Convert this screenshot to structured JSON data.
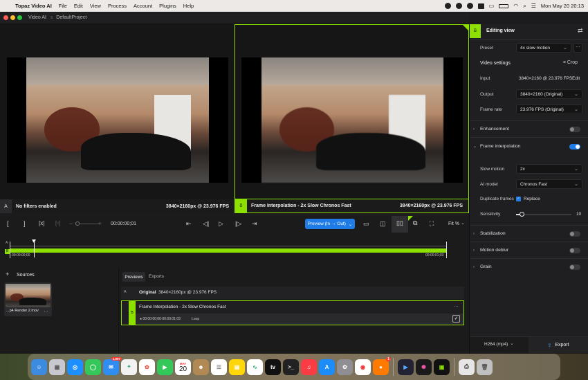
{
  "menubar": {
    "app": "Topaz Video AI",
    "items": [
      "File",
      "Edit",
      "View",
      "Process",
      "Account",
      "Plugins",
      "Help"
    ],
    "clock": "Mon May 20  20:13"
  },
  "titlebar": {
    "app": "Video AI",
    "sep": "S",
    "project": "DefaultProject"
  },
  "preview_a": {
    "tag": "A",
    "label": "No filters enabled",
    "meta": "3840×2160px @ 23.976 FPS"
  },
  "preview_b": {
    "tag": "0",
    "label": "Frame Interpolation -  2x Slow Chronos Fast",
    "meta": "3840×2160px @ 23.976 FPS"
  },
  "toolbar": {
    "bracket_in": "[",
    "bracket_out": "]",
    "timecode": "00:00:00;01",
    "preview_btn": "Preview (In → Out)",
    "fit": "Fit %"
  },
  "timeline": {
    "start": "00:00:00;00",
    "end": "00:00:01;03"
  },
  "sources": {
    "title": "Sources",
    "clip": "...p4 Render 2.mov"
  },
  "previews": {
    "tabs": [
      "Previews",
      "Exports"
    ],
    "original_tag": "A",
    "original_label": "Original",
    "original_meta": "3840×2160px @ 23.976 FPS",
    "item_tag": "B",
    "item_label": "Frame Interpolation -  2x Slow Chronos Fast",
    "item_range": "00:00:00;00-00:00:01;03",
    "item_loop": "Loop"
  },
  "sidebar": {
    "tag": "B",
    "title": "Editing view",
    "preset_label": "Preset",
    "preset_value": "4x slow motion",
    "video_settings": "Video settings",
    "crop": "Crop",
    "input_label": "Input",
    "input_value": "3840×2160 @ 23.976 FPS",
    "edit": "Edit",
    "output_label": "Output",
    "output_value": "3840×2160 (Original)",
    "framerate_label": "Frame rate",
    "framerate_value": "23.976 FPS (Original)",
    "enhancement": "Enhancement",
    "frame_interp": "Frame interpolation",
    "slowmo_label": "Slow motion",
    "slowmo_value": "2x",
    "aimodel_label": "AI model",
    "aimodel_value": "Chronos Fast",
    "dup_label": "Duplicate frames",
    "dup_value": "Replace",
    "sens_label": "Sensitivity",
    "sens_value": "10",
    "stabilization": "Stabilization",
    "motion_deblur": "Motion deblur",
    "grain": "Grain",
    "codec": "H264 (mp4)",
    "export": "Export"
  },
  "dock": {
    "mail_badge": "1,907",
    "cal_month": "MAY",
    "cal_day": "20",
    "app_badge": "1"
  },
  "colors": {
    "accent": "#8ee000",
    "blue": "#1f7ce6"
  }
}
